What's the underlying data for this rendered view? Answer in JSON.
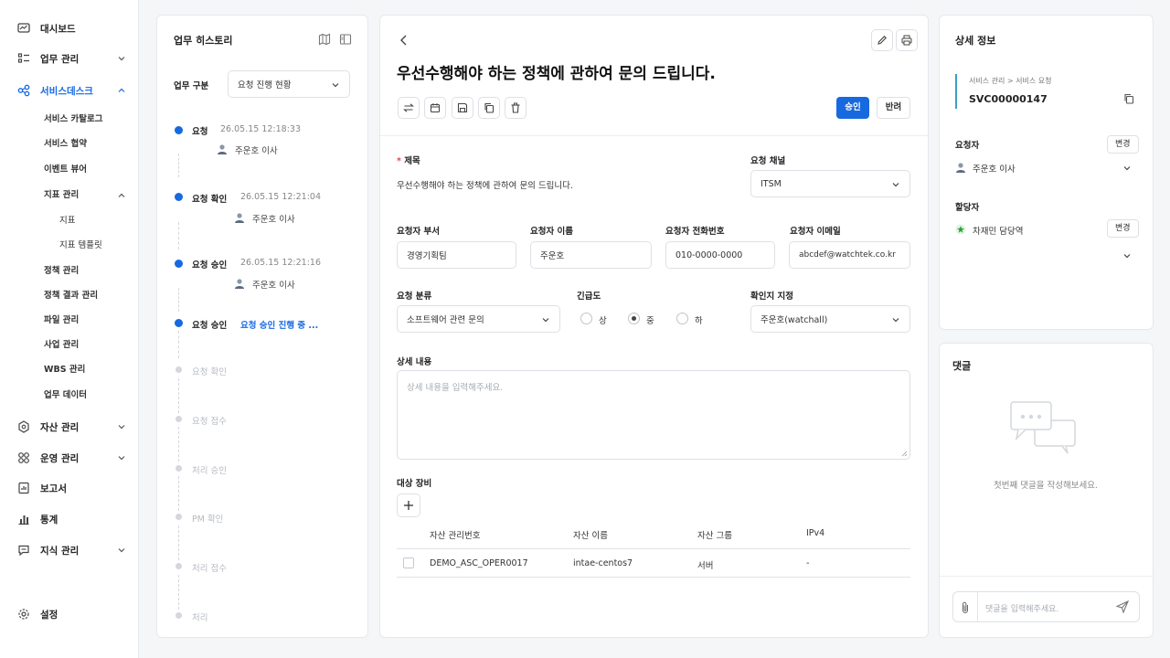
{
  "sidebar": {
    "items": [
      {
        "label": "대시보드",
        "icon": "dashboard-icon"
      },
      {
        "label": "업무 관리",
        "icon": "task-icon"
      },
      {
        "label": "서비스데스크",
        "icon": "servicedesk-icon"
      },
      {
        "label": "자산 관리",
        "icon": "asset-icon"
      },
      {
        "label": "운영 관리",
        "icon": "operation-icon"
      },
      {
        "label": "보고서",
        "icon": "report-icon"
      },
      {
        "label": "통계",
        "icon": "stats-icon"
      },
      {
        "label": "지식 관리",
        "icon": "knowledge-icon"
      },
      {
        "label": "설정",
        "icon": "gear-icon"
      }
    ],
    "subitems": [
      "서비스 카탈로그",
      "서비스 협약",
      "이벤트 뷰어",
      "지표 관리",
      "지표",
      "지표 템플릿",
      "정책 관리",
      "정책 결과 관리",
      "파일 관리",
      "사업 관리",
      "WBS 관리",
      "업무 데이터"
    ]
  },
  "history": {
    "title": "업무 히스토리",
    "filter_label": "업무 구분",
    "filter_value": "요청 진행 현황",
    "steps": [
      {
        "label": "요청",
        "time": "26.05.15 12:18:33",
        "user": "주운호 이사"
      },
      {
        "label": "요청 확인",
        "time": "26.05.15 12:21:04",
        "user": "주운호 이사"
      },
      {
        "label": "요청 승인",
        "time": "26.05.15 12:21:16",
        "user": "주운호 이사"
      },
      {
        "label": "요청 승인",
        "status": "요청 승인 진행 중 ..."
      },
      {
        "label": "요청 확인"
      },
      {
        "label": "요청 접수"
      },
      {
        "label": "처리 승인"
      },
      {
        "label": "PM 확인"
      },
      {
        "label": "처리 접수"
      },
      {
        "label": "처리"
      }
    ]
  },
  "main": {
    "title": "우선수행해야 하는 정책에 관하여 문의 드립니다.",
    "approve": "승인",
    "reject": "반려",
    "form": {
      "subject_label": "제목",
      "required_mark": "*",
      "subject_value": "우선수행해야 하는 정책에 관하여 문의 드립니다.",
      "channel_label": "요청 채널",
      "channel_value": "ITSM",
      "dept_label": "요청자 부서",
      "dept_value": "경영기획팀",
      "name_label": "요청자 이름",
      "name_value": "주운호",
      "phone_label": "요청자 전화번호",
      "phone_value": "010-0000-0000",
      "email_label": "요청자 이메일",
      "email_value": "abcdef@watchtek.co.kr",
      "category_label": "요청 분류",
      "category_value": "소프트웨어 관련 문의",
      "urgency_label": "긴급도",
      "urgency_options": [
        "상",
        "중",
        "하"
      ],
      "urgency_selected": "중",
      "confirmer_label": "확인지 지정",
      "confirmer_value": "주운호(watchall)",
      "detail_label": "상세 내용",
      "detail_placeholder": "상세 내용을 입력해주세요."
    },
    "equipment": {
      "label": "대상 장비",
      "columns": [
        "자산 관리번호",
        "자산 이름",
        "자산 그룹",
        "IPv4"
      ],
      "rows": [
        [
          "DEMO_ASC_OPER0017",
          "intae-centos7",
          "서버",
          "-"
        ]
      ]
    }
  },
  "detail": {
    "title": "상세 정보",
    "breadcrumb": "서비스 관리 > 서비스 요청",
    "id": "SVC00000147",
    "requester_label": "요청자",
    "requester_name": "주운호 이사",
    "change": "변경",
    "assignee_label": "할당자",
    "assignee_name": "차재민 담당역"
  },
  "comments": {
    "title": "댓글",
    "empty": "첫번째 댓글을 작성해보세요.",
    "placeholder": "댓글을 입력해주세요."
  },
  "colors": {
    "accent": "#1769e0",
    "border": "#e6e8ec"
  }
}
